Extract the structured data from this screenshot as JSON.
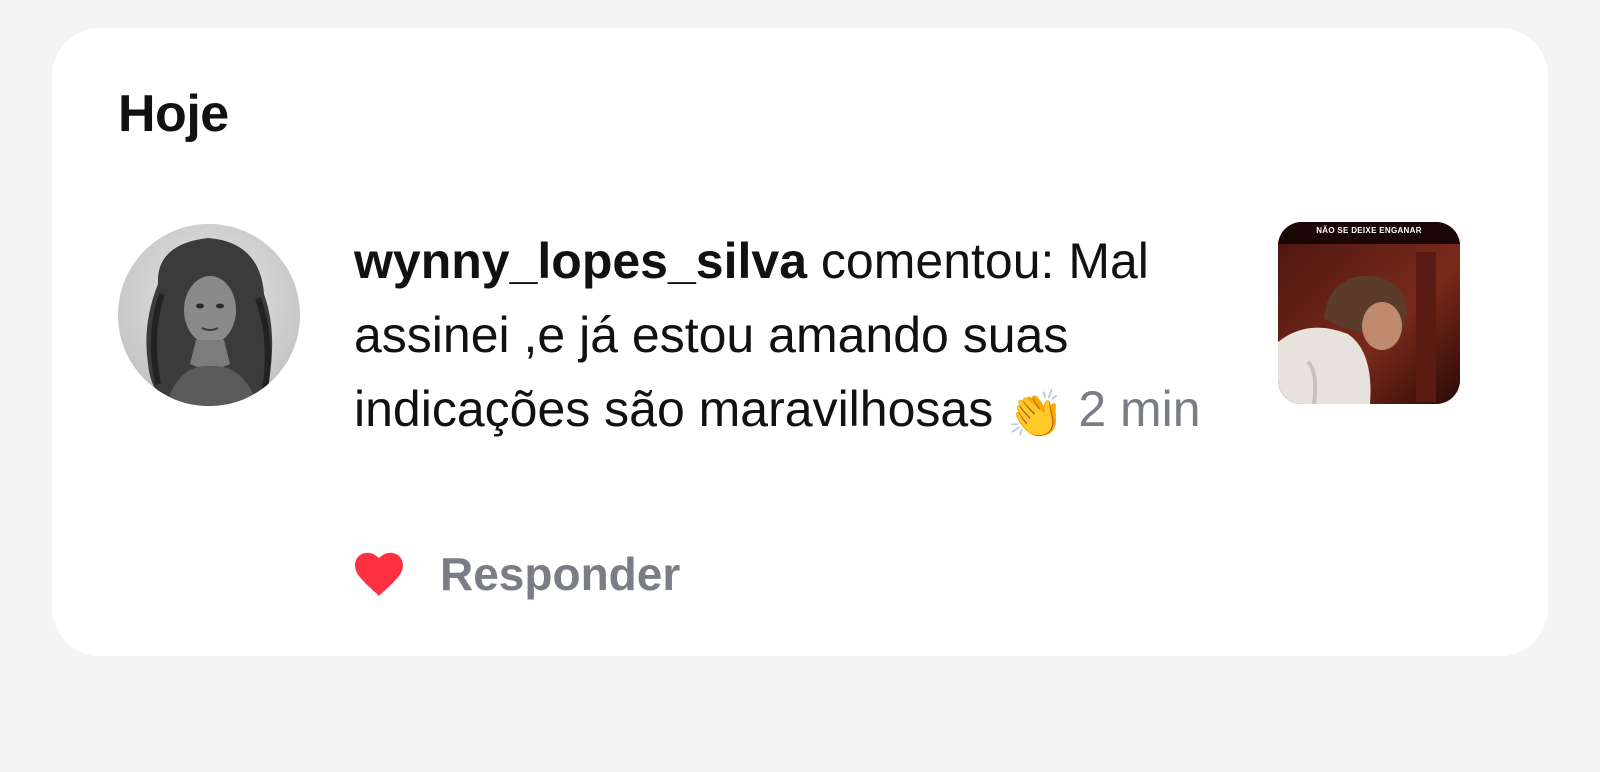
{
  "section": {
    "title": "Hoje"
  },
  "notification": {
    "username": "wynny_lopes_silva",
    "action": "comentou:",
    "comment": "Mal assinei ,e já estou amando suas indicações são maravilhosas",
    "emoji": "👏",
    "timestamp": "2 min",
    "avatar_icon": "user-avatar-photo",
    "thumbnail_caption": "NÃO SE DEIXE ENGANAR",
    "thumbnail_icon": "post-thumbnail"
  },
  "actions": {
    "like_icon": "heart-icon",
    "like_color": "#ff3040",
    "reply_label": "Responder"
  }
}
